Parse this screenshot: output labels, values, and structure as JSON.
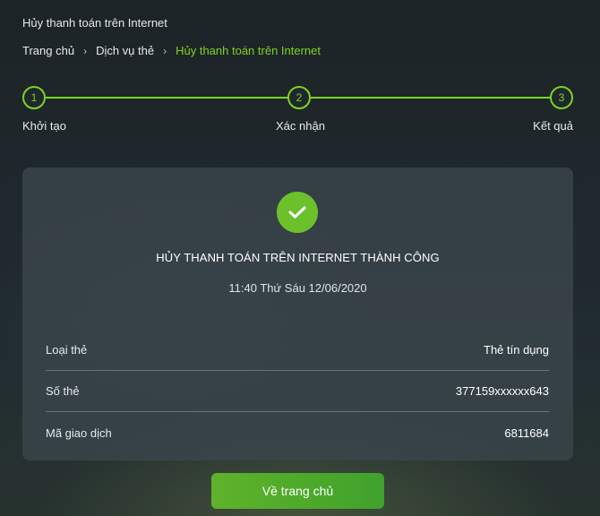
{
  "page": {
    "title": "Hủy thanh toán trên Internet"
  },
  "breadcrumb": {
    "items": [
      "Trang chủ",
      "Dịch vụ thẻ",
      "Hủy thanh toán trên Internet"
    ],
    "separator": "›"
  },
  "stepper": {
    "steps": [
      {
        "number": "1",
        "label": "Khởi tạo"
      },
      {
        "number": "2",
        "label": "Xác nhận"
      },
      {
        "number": "3",
        "label": "Kết quả"
      }
    ],
    "current_step": 3
  },
  "result": {
    "icon": "check-icon",
    "title": "HỦY THANH TOÁN TRÊN INTERNET THÀNH CÔNG",
    "time": "11:40 Thứ Sáu 12/06/2020",
    "details": [
      {
        "label": "Loại thẻ",
        "value": "Thẻ tín dụng"
      },
      {
        "label": "Số thẻ",
        "value": "377159xxxxxx643"
      },
      {
        "label": "Mã giao dịch",
        "value": "6811684"
      }
    ]
  },
  "actions": {
    "home_label": "Về trang chủ"
  },
  "colors": {
    "accent": "#7ed321",
    "success": "#6cc12b",
    "card_bg": "#3a464c",
    "page_bg": "#1f282c"
  }
}
